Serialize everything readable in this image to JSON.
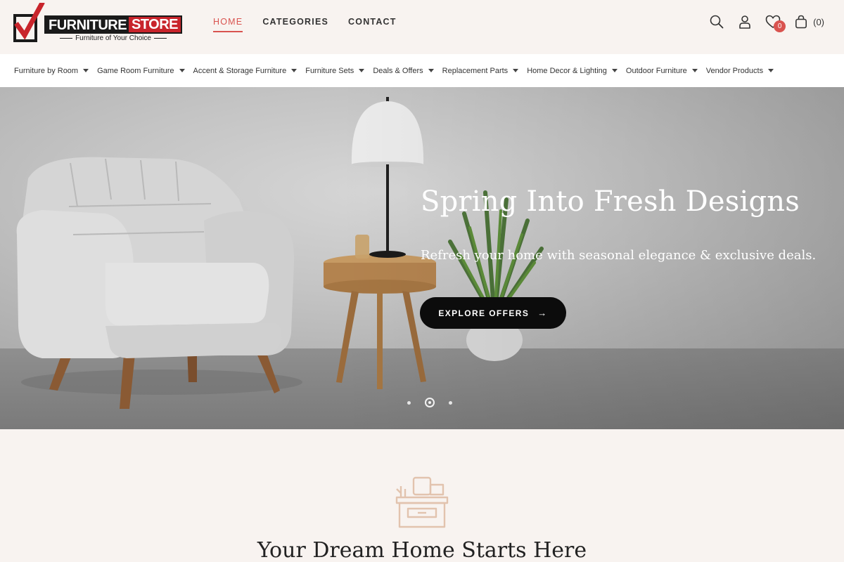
{
  "brand": {
    "name_part1": "FURNITURE",
    "name_part2": "STORE",
    "tagline": "Furniture of Your Choice",
    "accent_color": "#c8242b"
  },
  "main_nav": [
    {
      "label": "HOME",
      "active": true
    },
    {
      "label": "CATEGORIES",
      "active": false
    },
    {
      "label": "CONTACT",
      "active": false
    }
  ],
  "header_icons": {
    "search": "search-icon",
    "account": "user-icon",
    "wishlist": "heart-icon",
    "wishlist_count": "0",
    "cart": "shopping-bag-icon",
    "cart_count": "(0)"
  },
  "category_nav": [
    "Furniture by Room",
    "Game Room Furniture",
    "Accent & Storage Furniture",
    "Furniture Sets",
    "Deals & Offers",
    "Replacement Parts",
    "Home Decor & Lighting",
    "Outdoor Furniture",
    "Vendor Products"
  ],
  "hero": {
    "title": "Spring Into Fresh Designs",
    "subtitle": "Refresh your home with seasonal elegance & exclusive deals.",
    "cta_label": "EXPLORE OFFERS",
    "cta_icon": "arrow-right-icon",
    "slide_count": 3,
    "active_slide": 2
  },
  "section": {
    "icon": "desk-icon",
    "title": "Your Dream Home Starts Here"
  }
}
